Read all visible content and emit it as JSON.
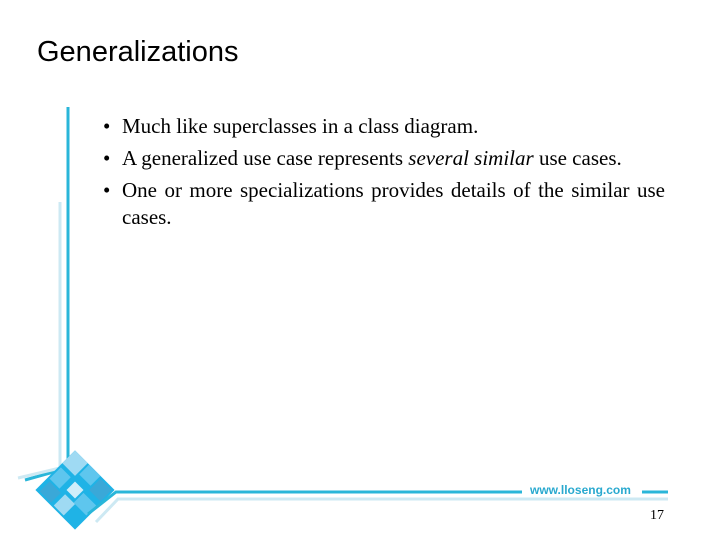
{
  "slide": {
    "title": "Generalizations",
    "bullets": [
      {
        "parts": [
          {
            "text": "Much like superclasses in a class diagram.",
            "italic": false
          }
        ]
      },
      {
        "parts": [
          {
            "text": "A generalized use case represents ",
            "italic": false
          },
          {
            "text": "several similar",
            "italic": true
          },
          {
            "text": " use cases.",
            "italic": false
          }
        ]
      },
      {
        "parts": [
          {
            "text": "One or more specializations provides details of the similar use cases.",
            "italic": false
          }
        ]
      }
    ],
    "footer_url": "www.lloseng.com",
    "page_number": "17"
  },
  "theme": {
    "accent": "#29b6d9",
    "accent_light": "#cde9f3",
    "logo_tile_colors": [
      "#1fb3e6",
      "#5ec6ee",
      "#9fdaf3",
      "#3aa8d8"
    ]
  }
}
